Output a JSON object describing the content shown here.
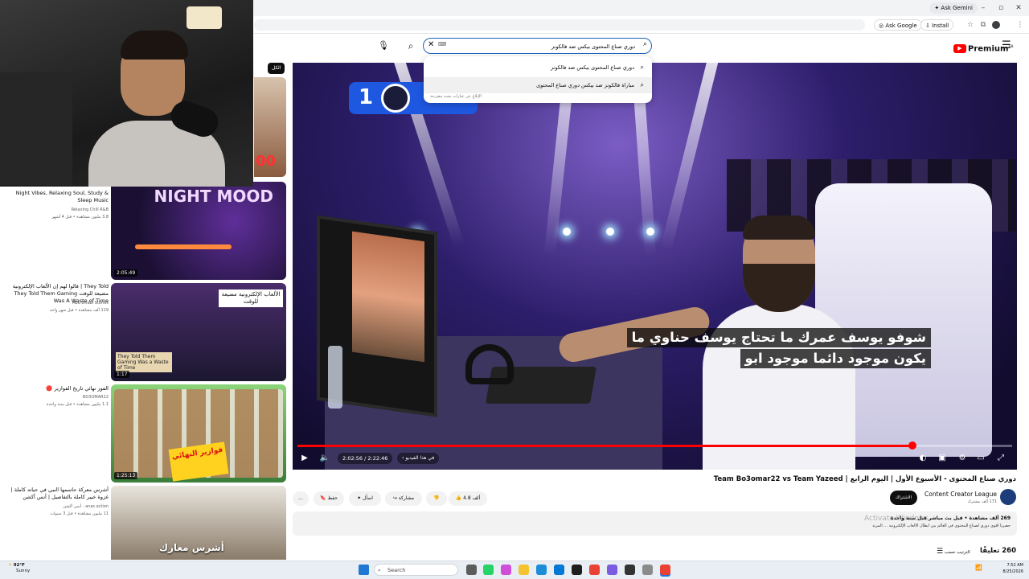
{
  "browser": {
    "ask_gemini": "Ask Gemini",
    "ask_google": "Ask Google",
    "install": "Install"
  },
  "header": {
    "search_value": "دوري صناع المحتوى بيكس ضد فالكونز",
    "logo_text": "Premium",
    "logo_sup": "SA"
  },
  "suggestions": [
    "دوري صناع المحتوى بيكس ضد فالكونز",
    "مباراة فالكونز ضد بيكس دوري صناع المحتوى"
  ],
  "suggest_report": "الإبلاغ عن عبارات بحث مقترحة",
  "chip_live": "الكل",
  "sidebar_list": [
    {
      "title": "Night Vibes, Relaxing Soul, Study & Sleep Music",
      "channel": "Relaxing Chill R&B",
      "meta": "3.8 مليون مشاهدة • قبل 4 أشهر",
      "duration": "2:05:49",
      "thumb_text": "NIGHT MOOD"
    },
    {
      "title": "They Told | قالوا لهم إن الألعاب الإلكترونية مضيعة للوقت They Told Them Gaming Was A Waste of Time",
      "channel": "Abu Dhabi Stories",
      "meta": "119 ألف مشاهدة • قبل شهر واحد",
      "duration": "1:17",
      "thumb_title": "الألعاب الإلكترونية مضيعة للوقت",
      "thumb_caption": "They Told Them Gaming Was a Waste of Time"
    },
    {
      "title": "الفوز نهائي تاريخ الفوازير 🔴",
      "channel": "BO3OMAR22",
      "meta": "1.1 مليون مشاهدة • قبل سنة واحدة",
      "duration": "1:25:13",
      "thumb_tag": "فوازير النهائي"
    },
    {
      "title": "أشرس معركة حاسمها النبي في حياته كاملة | غزوة خيبر كاملة بالتفاصيل | أنس أكشن",
      "channel": "anas action - أنس أكشن",
      "meta": "11 مليون مشاهدة • قبل 3 سنوات",
      "duration": "",
      "thumb_caption": "أشرس معارك"
    }
  ],
  "top_thumb_num": "00",
  "player": {
    "subtitle_line1": "شوفو يوسف عمرك ما تحتاج يوسف حناوي ما",
    "subtitle_line2": "يكون موجود دائما موجود ابو",
    "time": "2:02:56 / 2:22:46",
    "chapter": "في هذا الفيديو",
    "progress_percent": 86,
    "score_left": "1"
  },
  "video": {
    "title": "دوري صناع المحتوى - الأسبوع الأول | اليوم الرابع | Team Bo3omar22 vs Team Yazeed",
    "channel": "Content Creator League",
    "subs": "171 ألف مشترك",
    "subscribe": "الاشتراك",
    "likes": "4.8 ألف",
    "share": "مشاركة",
    "ask": "اسأل",
    "save": "حفظ",
    "more": "..."
  },
  "description": {
    "stats": "269 ألف مشاهدة • قبل بث مباشر قبل سنة واحدة",
    "text": "حصرياً أقوى دوري لصناع المحتوى في العالم بين أبطال الألعاب الإلكترونية ... المزيد"
  },
  "watermark": "Activate Windows",
  "comments": {
    "count": "260 تعليقًا",
    "sort": "الترتيب حسب"
  },
  "taskbar": {
    "weather_temp": "92°F",
    "weather_desc": "Sunny",
    "search": "Search",
    "time": "7:52 AM",
    "date": "8/25/2026"
  }
}
